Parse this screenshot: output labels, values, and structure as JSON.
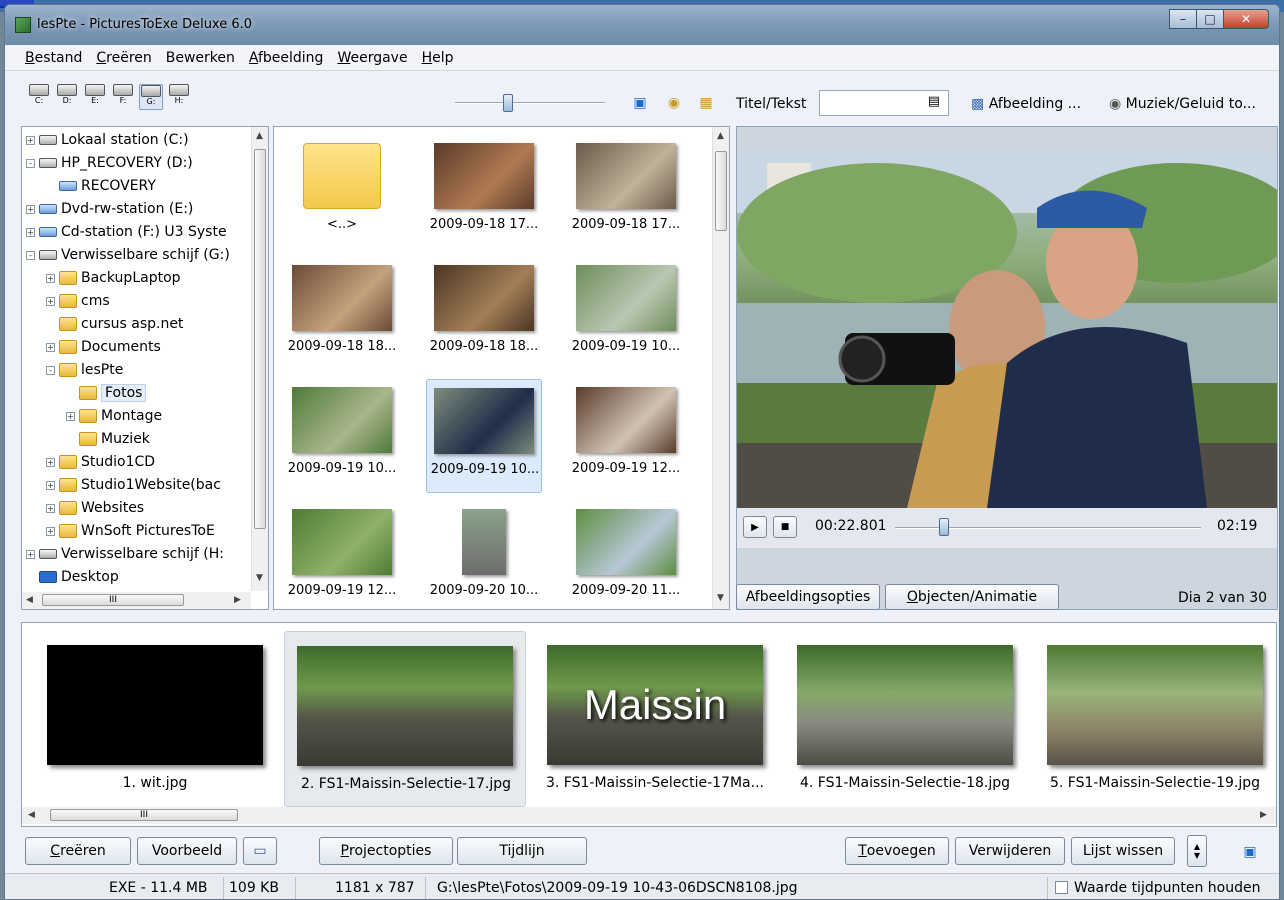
{
  "window": {
    "title": "lesPte - PicturesToExe Deluxe 6.0"
  },
  "menu": [
    {
      "label": "Bestand",
      "key": "B",
      "rest": "estand"
    },
    {
      "label": "Creëren",
      "key": "C",
      "rest": "reëren"
    },
    {
      "label": "Bewerken",
      "key": "B",
      "rest": "ewerken"
    },
    {
      "label": "Afbeelding",
      "key": "A",
      "rest": "fbeelding"
    },
    {
      "label": "Weergave",
      "key": "W",
      "rest": "eergave"
    },
    {
      "label": "Help",
      "key": "H",
      "rest": "elp"
    }
  ],
  "drives": [
    "C:",
    "D:",
    "E:",
    "F:",
    "G:",
    "H:"
  ],
  "toolbar": {
    "zoom_level": 0.35,
    "title_text_label": "Titel/Tekst",
    "title_text_value": "",
    "image_button": "Afbeelding ...",
    "music_button": "Muziek/Geluid to..."
  },
  "tree": [
    {
      "label": "Lokaal station (C:)",
      "icon": "hard-drive-icon"
    },
    {
      "label": "HP_RECOVERY (D:)",
      "icon": "hard-drive-icon"
    },
    {
      "label": "RECOVERY",
      "icon": "cd-icon"
    },
    {
      "label": "Dvd-rw-station (E:)",
      "icon": "dvd-drive-icon"
    },
    {
      "label": "Cd-station (F:) U3 Syste",
      "icon": "cd-drive-icon"
    },
    {
      "label": "Verwisselbare schijf (G:)",
      "icon": "removable-drive-icon"
    },
    {
      "label": "BackupLaptop",
      "icon": "folder-icon"
    },
    {
      "label": "cms",
      "icon": "folder-icon"
    },
    {
      "label": "cursus asp.net",
      "icon": "folder-icon"
    },
    {
      "label": "Documents",
      "icon": "folder-icon"
    },
    {
      "label": "lesPte",
      "icon": "folder-icon"
    },
    {
      "label": "Fotos",
      "icon": "folder-icon"
    },
    {
      "label": "Montage",
      "icon": "folder-icon"
    },
    {
      "label": "Muziek",
      "icon": "folder-icon"
    },
    {
      "label": "Studio1CD",
      "icon": "folder-icon"
    },
    {
      "label": "Studio1Website(bac",
      "icon": "folder-icon"
    },
    {
      "label": "Websites",
      "icon": "folder-icon"
    },
    {
      "label": "WnSoft PicturesToE",
      "icon": "folder-icon"
    },
    {
      "label": "Verwisselbare schijf (H:",
      "icon": "removable-drive-icon"
    },
    {
      "label": "Desktop",
      "icon": "desktop-icon"
    }
  ],
  "tree_scroll_label": "III",
  "files": [
    "<..>",
    "2009-09-18 17...",
    "2009-09-18 17...",
    "2009-09-18 18...",
    "2009-09-18 18...",
    "2009-09-19 10...",
    "2009-09-19 10...",
    "2009-09-19 10...",
    "2009-09-19 12...",
    "2009-09-19 12...",
    "2009-09-20 10...",
    "2009-09-20 11..."
  ],
  "player": {
    "time": "00:22.801",
    "duration": "02:19",
    "position": 0.16
  },
  "preview_buttons": {
    "image_options": "Afbeeldingsopties",
    "objects_key": "O",
    "objects_rest": "bjecten/Animatie"
  },
  "slide_counter": "Dia 2 van 30",
  "slides": [
    "1. wit.jpg",
    "2. FS1-Maissin-Selectie-17.jpg",
    "3. FS1-Maissin-Selectie-17Ma...",
    "4. FS1-Maissin-Selectie-18.jpg",
    "5. FS1-Maissin-Selectie-19.jpg"
  ],
  "slide3_overlay": "Maissin",
  "strip_scroll_label": "III",
  "bottom_buttons": {
    "create_key": "C",
    "create_rest": "reëren",
    "preview": "Voorbeeld",
    "project_key": "P",
    "project_rest": "rojectopties",
    "timeline": "Tijdlijn",
    "add_key": "T",
    "add_rest": "oevoegen",
    "remove": "Verwijderen",
    "clear": "Lijst wissen"
  },
  "status": {
    "exe": "EXE - 11.4 MB",
    "size": "109 KB",
    "dims": "1181 x 787",
    "path": "G:\\lesPte\\Fotos\\2009-09-19 10-43-06DSCN8108.jpg",
    "keep_label": "Waarde tijdpunten houden"
  },
  "colors": {
    "selection": "#dcebfb",
    "title_gradient": "#7f9bb9",
    "close_red": "#c0412b"
  }
}
